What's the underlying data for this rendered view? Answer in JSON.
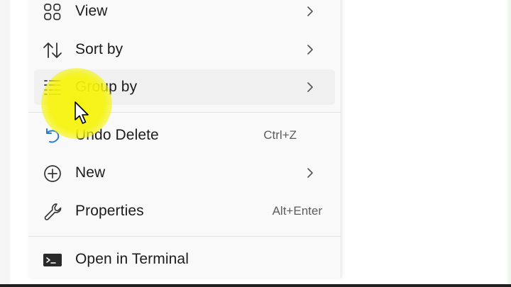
{
  "menu": {
    "items": [
      {
        "label": "View",
        "icon": "view-grid-icon",
        "submenu": true
      },
      {
        "label": "Sort by",
        "icon": "sort-arrows-icon",
        "submenu": true
      },
      {
        "label": "Group by",
        "icon": "group-list-icon",
        "submenu": true
      },
      {
        "label": "Undo Delete",
        "icon": "undo-icon",
        "shortcut": "Ctrl+Z"
      },
      {
        "label": "New",
        "icon": "add-circle-icon",
        "submenu": true
      },
      {
        "label": "Properties",
        "icon": "wrench-icon",
        "shortcut": "Alt+Enter"
      },
      {
        "label": "Open in Terminal",
        "icon": "terminal-icon"
      }
    ]
  },
  "colors": {
    "cursor_highlight": "#f6f40a",
    "menu_background": "#f9f9f9",
    "hover_background": "#f0f0f0",
    "undo_icon": "#2b7ad0"
  }
}
